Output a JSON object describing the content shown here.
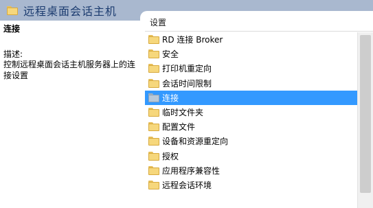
{
  "header": {
    "title": "远程桌面会话主机",
    "icon": "folder-icon"
  },
  "details": {
    "name": "连接",
    "description_label": "描述:",
    "description_text": "控制远程桌面会话主机服务器上的连接设置"
  },
  "list": {
    "column_header": "设置",
    "items": [
      {
        "label": "RD 连接 Broker",
        "icon": "folder-icon"
      },
      {
        "label": "安全",
        "icon": "folder-icon"
      },
      {
        "label": "打印机重定向",
        "icon": "folder-icon"
      },
      {
        "label": "会话时间限制",
        "icon": "folder-icon"
      },
      {
        "label": "连接",
        "icon": "folder-icon",
        "selected": true
      },
      {
        "label": "临时文件夹",
        "icon": "folder-icon"
      },
      {
        "label": "配置文件",
        "icon": "folder-icon"
      },
      {
        "label": "设备和资源重定向",
        "icon": "folder-icon"
      },
      {
        "label": "授权",
        "icon": "folder-icon"
      },
      {
        "label": "应用程序兼容性",
        "icon": "folder-icon"
      },
      {
        "label": "远程会话环境",
        "icon": "folder-icon"
      }
    ]
  },
  "colors": {
    "header_bg": "#a9b8cf",
    "selection": "#3399ff",
    "folder": "#f6d77c"
  }
}
